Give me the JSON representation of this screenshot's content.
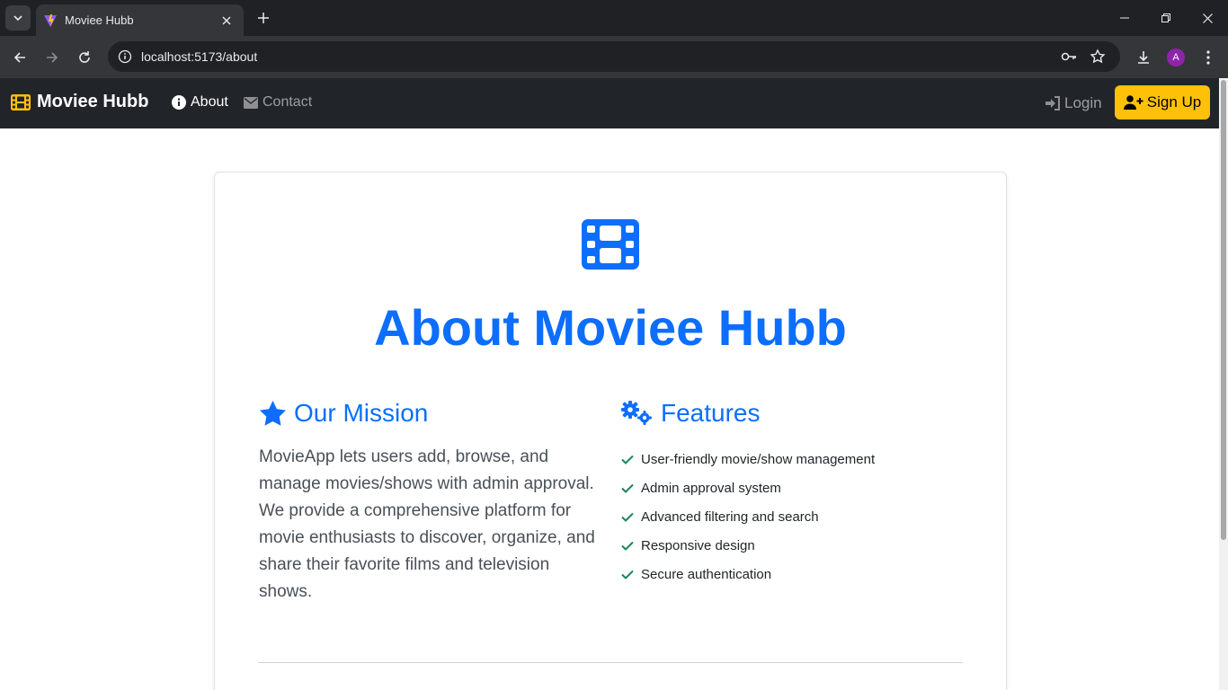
{
  "browser": {
    "tab_title": "Moviee Hubb",
    "url": "localhost:5173/about",
    "profile_initial": "A"
  },
  "navbar": {
    "brand": "Moviee Hubb",
    "links": [
      {
        "label": "About",
        "active": true
      },
      {
        "label": "Contact",
        "active": false
      }
    ],
    "login_label": "Login",
    "signup_label": "Sign Up"
  },
  "page": {
    "title": "About Moviee Hubb",
    "mission": {
      "heading": "Our Mission",
      "text": "MovieApp lets users add, browse, and manage movies/shows with admin approval. We provide a comprehensive platform for movie enthusiasts to discover, organize, and share their favorite films and television shows."
    },
    "features": {
      "heading": "Features",
      "items": [
        "User-friendly movie/show management",
        "Admin approval system",
        "Advanced filtering and search",
        "Responsive design",
        "Secure authentication"
      ]
    }
  },
  "colors": {
    "primary": "#0d6efd",
    "navbar_bg": "#212529",
    "signup_bg": "#ffc107",
    "check": "#198754"
  },
  "icons": {
    "brand": "film-icon",
    "about": "info-circle-icon",
    "contact": "envelope-icon",
    "login": "sign-in-icon",
    "signup": "user-plus-icon",
    "mission": "star-icon",
    "features": "cogs-icon",
    "feature_item": "check-icon"
  }
}
